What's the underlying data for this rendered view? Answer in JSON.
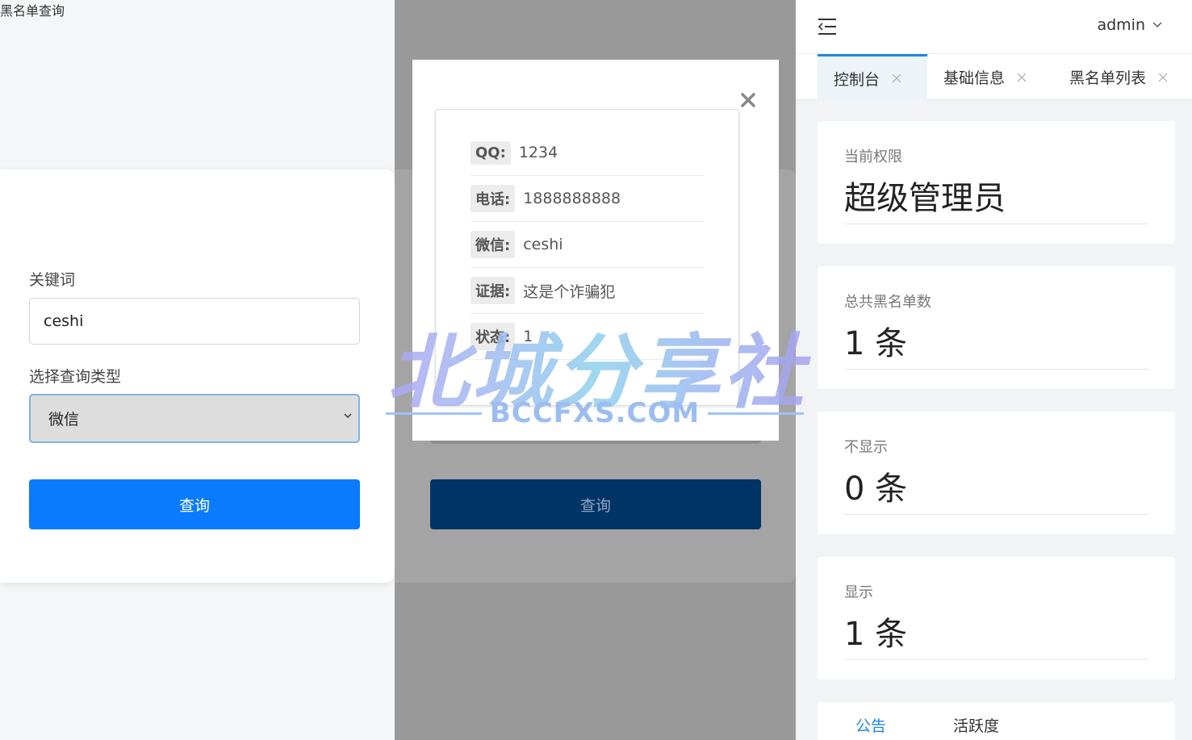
{
  "query_page": {
    "title": "黑名单查询",
    "keyword_label": "关键词",
    "keyword_value": "ceshi",
    "type_label": "选择查询类型",
    "type_value": "微信",
    "submit_label": "查询"
  },
  "result_modal": {
    "close_symbol": "×",
    "submit_label": "查询",
    "rows": [
      {
        "key": "QQ:",
        "value": "1234"
      },
      {
        "key": "电话:",
        "value": "1888888888"
      },
      {
        "key": "微信:",
        "value": "ceshi"
      },
      {
        "key": "证据:",
        "value": "这是个诈骗犯"
      },
      {
        "key": "状态:",
        "value": "1"
      }
    ]
  },
  "admin": {
    "user": "admin",
    "tabs": [
      {
        "label": "控制台",
        "active": true
      },
      {
        "label": "基础信息",
        "active": false
      },
      {
        "label": "黑名单列表",
        "active": false
      }
    ],
    "stats": [
      {
        "label": "当前权限",
        "value": "超级管理员"
      },
      {
        "label": "总共黑名单数",
        "value": "1 条"
      },
      {
        "label": "不显示",
        "value": "0 条"
      },
      {
        "label": "显示",
        "value": "1 条"
      }
    ],
    "bottom_tabs": [
      {
        "label": "公告",
        "active": true
      },
      {
        "label": "活跃度",
        "active": false
      }
    ],
    "colors": {
      "accent": "#1e88e5",
      "primary_button": "#0a7bff"
    }
  },
  "watermark": {
    "main": "北城分享社",
    "sub": "BCCFXS.COM"
  }
}
